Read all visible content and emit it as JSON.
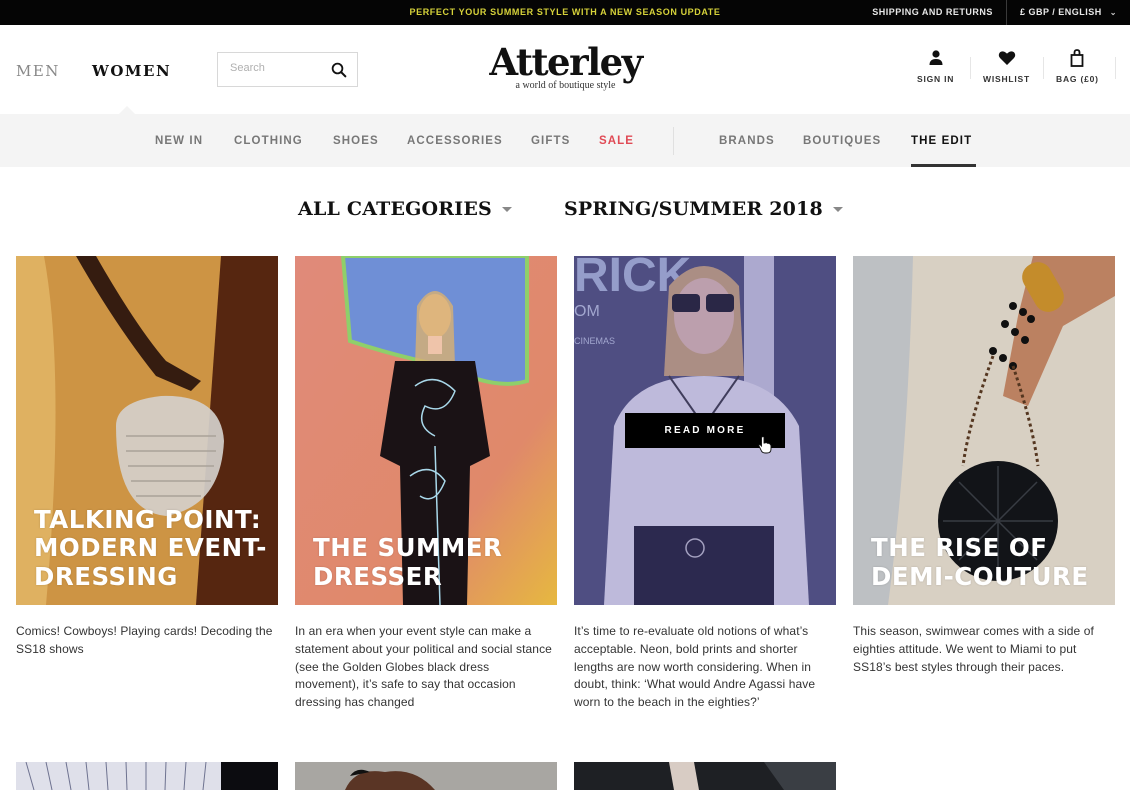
{
  "promo": {
    "message": "PERFECT YOUR SUMMER STYLE WITH A NEW SEASON UPDATE",
    "shipping_link": "SHIPPING AND RETURNS",
    "locale_selector": "£ GBP / ENGLISH",
    "locale_icon": "chevron-down-icon",
    "accent_color": "#d6d23a"
  },
  "header": {
    "gender_men": "MEN",
    "gender_women": "WOMEN",
    "search_placeholder": "Search",
    "search_value": "",
    "logo_name": "Atterley",
    "logo_tagline": "a world of boutique style",
    "sign_in": "SIGN IN",
    "wishlist": "WISHLIST",
    "bag": "BAG (£0)",
    "icons": [
      "search-icon",
      "user-icon",
      "heart-icon",
      "bag-icon"
    ]
  },
  "nav": {
    "items": [
      {
        "label": "NEW IN"
      },
      {
        "label": "CLOTHING"
      },
      {
        "label": "SHOES"
      },
      {
        "label": "ACCESSORIES"
      },
      {
        "label": "GIFTS"
      },
      {
        "label": "SALE"
      },
      {
        "label": "BRANDS"
      },
      {
        "label": "BOUTIQUES"
      },
      {
        "label": "THE EDIT"
      }
    ],
    "active": "THE EDIT",
    "sale_color": "#e04a55"
  },
  "filters": {
    "category": "ALL CATEGORIES",
    "season": "SPRING/SUMMER 2018"
  },
  "articles": [
    {
      "title": "TALKING POINT: MODERN EVENT-DRESSING",
      "description": "Comics! Cowboys! Playing cards! Decoding the SS18 shows"
    },
    {
      "title": "THE SUMMER DRESSER",
      "description": "In an era when your event style can make a statement about your political and social stance (see the Golden Globes black dress movement), it’s safe to say that occasion dressing has changed"
    },
    {
      "title": "",
      "description": "It’s time to re-evaluate old notions of what’s acceptable. Neon, bold prints and shorter lengths are now worth considering. When in doubt, think: ‘What would Andre Agassi have worn to the beach in the eighties?’",
      "hover_button": "READ MORE"
    },
    {
      "title": "THE RISE OF DEMI-COUTURE",
      "description": "This season, swimwear comes with a side of eighties attitude. We went to Miami to put SS18’s best styles through their paces."
    }
  ]
}
